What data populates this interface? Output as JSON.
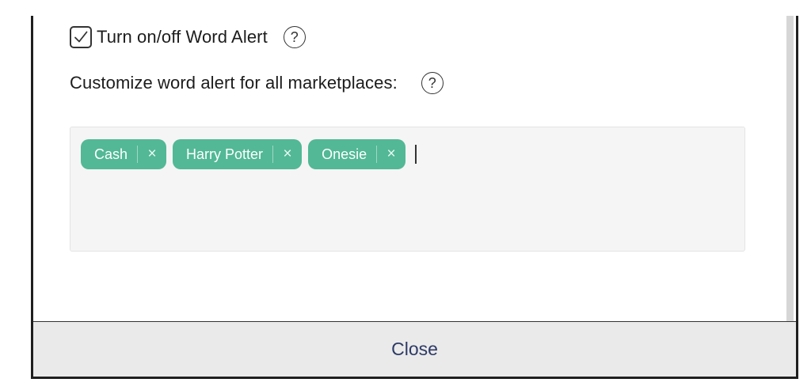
{
  "word_alert": {
    "toggle_label": "Turn on/off Word Alert",
    "checked": true,
    "toggle_help": "?",
    "customize_label": "Customize word alert for all marketplaces:",
    "customize_help": "?"
  },
  "tags": [
    {
      "label": "Cash",
      "remove": "×"
    },
    {
      "label": "Harry Potter",
      "remove": "×"
    },
    {
      "label": "Onesie",
      "remove": "×"
    }
  ],
  "footer": {
    "close_label": "Close"
  },
  "colors": {
    "tag_background": "#52b896",
    "close_text": "#2d3a66",
    "footer_background": "#eaeaea"
  }
}
